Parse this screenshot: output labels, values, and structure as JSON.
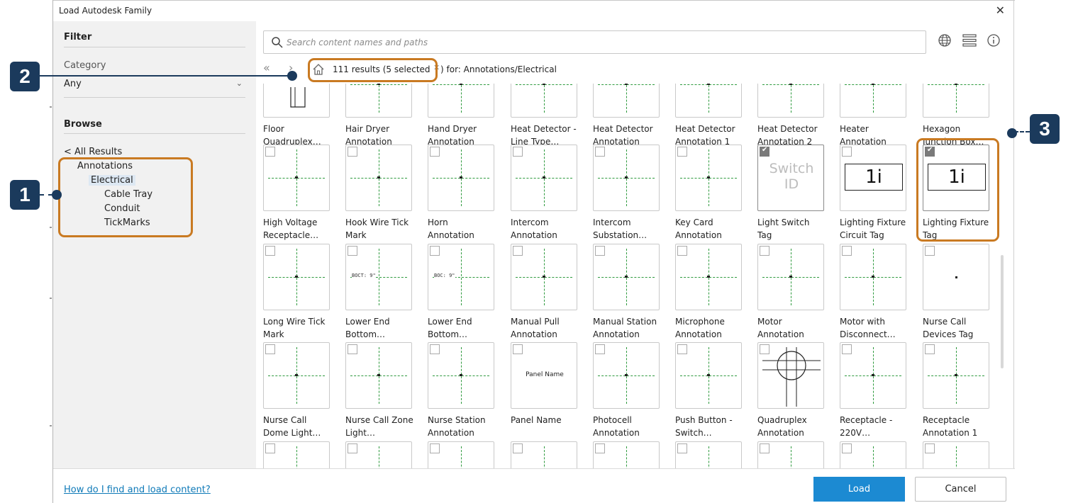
{
  "window": {
    "title": "Load Autodesk Family",
    "close_glyph": "✕"
  },
  "sidebar": {
    "filter_heading": "Filter",
    "category_label": "Category",
    "category_value": "Any",
    "browse_heading": "Browse",
    "tree": {
      "all_results": "< All Results",
      "annotations": "Annotations",
      "electrical": "Electrical",
      "cable_tray": "Cable Tray",
      "conduit": "Conduit",
      "tickmarks": "TickMarks"
    }
  },
  "search": {
    "placeholder": "Search content names and paths",
    "icon": "search-icon"
  },
  "toolbar_icons": [
    "globe-icon",
    "list-view-icon",
    "info-icon"
  ],
  "nav": {
    "results": "111 results (5 selected",
    "for_text": ") for: Annotations/Electrical",
    "back_glyph": "«",
    "forward_glyph": "›",
    "home_icon": "home-icon",
    "clear_glyph": "✕"
  },
  "tiles": [
    {
      "l1": "Floor",
      "l2": "Quadruplex…",
      "checked": false,
      "preview": "floor"
    },
    {
      "l1": "Hair Dryer",
      "l2": "Annotation",
      "checked": false,
      "preview": "cross"
    },
    {
      "l1": "Hand Dryer",
      "l2": "Annotation",
      "checked": false,
      "preview": "cross"
    },
    {
      "l1": "Heat Detector -",
      "l2": "Line Type…",
      "checked": false,
      "preview": "cross"
    },
    {
      "l1": "Heat Detector",
      "l2": "Annotation",
      "checked": false,
      "preview": "cross"
    },
    {
      "l1": "Heat Detector",
      "l2": "Annotation 1",
      "checked": false,
      "preview": "cross"
    },
    {
      "l1": "Heat Detector",
      "l2": "Annotation 2",
      "checked": false,
      "preview": "cross"
    },
    {
      "l1": "Heater",
      "l2": "Annotation",
      "checked": false,
      "preview": "cross"
    },
    {
      "l1": "Hexagon",
      "l2": "Junction Box…",
      "checked": false,
      "preview": "cross"
    },
    {
      "l1": "High Voltage",
      "l2": "Receptacle…",
      "checked": false,
      "preview": "cross"
    },
    {
      "l1": "Hook Wire Tick",
      "l2": "Mark",
      "checked": false,
      "preview": "cross"
    },
    {
      "l1": "Horn",
      "l2": "Annotation",
      "checked": false,
      "preview": "cross"
    },
    {
      "l1": "Intercom",
      "l2": "Annotation",
      "checked": false,
      "preview": "cross"
    },
    {
      "l1": "Intercom",
      "l2": "Substation…",
      "checked": false,
      "preview": "cross"
    },
    {
      "l1": "Key Card",
      "l2": "Annotation",
      "checked": false,
      "preview": "cross"
    },
    {
      "l1": "Light Switch",
      "l2": "Tag",
      "checked": true,
      "preview": "switch",
      "preview_text": "Switch ID"
    },
    {
      "l1": "Lighting Fixture",
      "l2": "Circuit Tag",
      "checked": false,
      "preview": "tag",
      "preview_text": "1i"
    },
    {
      "l1": "Lighting Fixture",
      "l2": "Tag",
      "checked": true,
      "preview": "tag",
      "preview_text": "1i"
    },
    {
      "l1": "Long Wire Tick",
      "l2": "Mark",
      "checked": false,
      "preview": "cross"
    },
    {
      "l1": "Lower End",
      "l2": "Bottom…",
      "checked": false,
      "preview": "note",
      "preview_text": "BOCT: 9\""
    },
    {
      "l1": "Lower End",
      "l2": "Bottom…",
      "checked": false,
      "preview": "note",
      "preview_text": "BOC: 9\""
    },
    {
      "l1": "Manual Pull",
      "l2": "Annotation",
      "checked": false,
      "preview": "cross"
    },
    {
      "l1": "Manual Station",
      "l2": "Annotation",
      "checked": false,
      "preview": "cross"
    },
    {
      "l1": "Microphone",
      "l2": "Annotation",
      "checked": false,
      "preview": "cross"
    },
    {
      "l1": "Motor",
      "l2": "Annotation",
      "checked": false,
      "preview": "cross"
    },
    {
      "l1": "Motor with",
      "l2": "Disconnect…",
      "checked": false,
      "preview": "cross"
    },
    {
      "l1": "Nurse Call",
      "l2": "Devices Tag",
      "checked": false,
      "preview": "dot"
    },
    {
      "l1": "Nurse Call",
      "l2": "Dome Light…",
      "checked": false,
      "preview": "cross"
    },
    {
      "l1": "Nurse Call Zone",
      "l2": "Light…",
      "checked": false,
      "preview": "cross"
    },
    {
      "l1": "Nurse Station",
      "l2": "Annotation",
      "checked": false,
      "preview": "cross"
    },
    {
      "l1": "Panel Name",
      "l2": "",
      "checked": false,
      "preview": "panel",
      "preview_text": "Panel Name"
    },
    {
      "l1": "Photocell",
      "l2": "Annotation",
      "checked": false,
      "preview": "cross"
    },
    {
      "l1": "Push Button -",
      "l2": "Switch…",
      "checked": false,
      "preview": "cross"
    },
    {
      "l1": "Quadruplex",
      "l2": "Annotation",
      "checked": false,
      "preview": "quad"
    },
    {
      "l1": "Receptacle -",
      "l2": "220V…",
      "checked": false,
      "preview": "cross"
    },
    {
      "l1": "Receptacle",
      "l2": "Annotation 1",
      "checked": false,
      "preview": "cross"
    },
    {
      "l1": "",
      "l2": "",
      "checked": false,
      "preview": "cross"
    },
    {
      "l1": "",
      "l2": "",
      "checked": false,
      "preview": "cross"
    },
    {
      "l1": "",
      "l2": "",
      "checked": false,
      "preview": "cross"
    },
    {
      "l1": "",
      "l2": "",
      "checked": false,
      "preview": "cross"
    },
    {
      "l1": "",
      "l2": "",
      "checked": false,
      "preview": "cross"
    },
    {
      "l1": "",
      "l2": "",
      "checked": false,
      "preview": "cross"
    },
    {
      "l1": "",
      "l2": "",
      "checked": false,
      "preview": "cross"
    },
    {
      "l1": "",
      "l2": "",
      "checked": false,
      "preview": "cross"
    },
    {
      "l1": "",
      "l2": "",
      "checked": false,
      "preview": "cross"
    }
  ],
  "footer": {
    "help": "How do I find and load content?",
    "load": "Load",
    "cancel": "Cancel"
  },
  "callouts": [
    "1",
    "2",
    "3"
  ],
  "colors": {
    "accent": "#1c8ad2",
    "callout_border": "#c97a22",
    "badge": "#1b3a5c",
    "link": "#0f7ab8",
    "guide_lines": "#2e9a3e"
  }
}
